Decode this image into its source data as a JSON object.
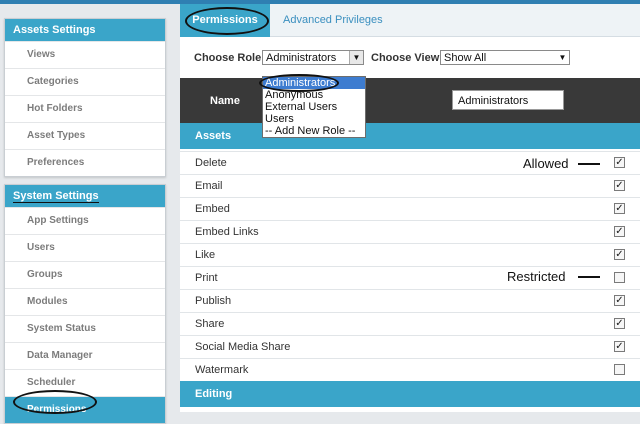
{
  "sidebar": {
    "assets_settings": {
      "title": "Assets Settings",
      "items": [
        "Views",
        "Categories",
        "Hot Folders",
        "Asset Types",
        "Preferences"
      ]
    },
    "system_settings": {
      "title": "System Settings",
      "items": [
        "App Settings",
        "Users",
        "Groups",
        "Modules",
        "System Status",
        "Data Manager",
        "Scheduler",
        "Permissions"
      ],
      "active": "Permissions"
    }
  },
  "tabs": {
    "active": "Permissions",
    "other": "Advanced Privileges"
  },
  "filter": {
    "role_label": "Choose Role:",
    "role_value": "Administrators",
    "view_label": "Choose View:",
    "view_value": "Show All"
  },
  "role_options": [
    "Administrators",
    "Anonymous",
    "External Users",
    "Users",
    "-- Add New Role --"
  ],
  "header": {
    "name_label": "Name",
    "name_value": "Administrators"
  },
  "sections": {
    "assets": "Assets",
    "editing": "Editing"
  },
  "permissions": [
    {
      "label": "Delete",
      "checked": true
    },
    {
      "label": "Email",
      "checked": true
    },
    {
      "label": "Embed",
      "checked": true
    },
    {
      "label": "Embed Links",
      "checked": true
    },
    {
      "label": "Like",
      "checked": true
    },
    {
      "label": "Print",
      "checked": false
    },
    {
      "label": "Publish",
      "checked": true
    },
    {
      "label": "Share",
      "checked": true
    },
    {
      "label": "Social Media Share",
      "checked": true
    },
    {
      "label": "Watermark",
      "checked": false
    }
  ],
  "annotations": {
    "allowed": "Allowed",
    "restricted": "Restricted"
  },
  "colors": {
    "accent": "#3aa5c9",
    "header_dark": "#393939",
    "link": "#3a8fbf"
  }
}
